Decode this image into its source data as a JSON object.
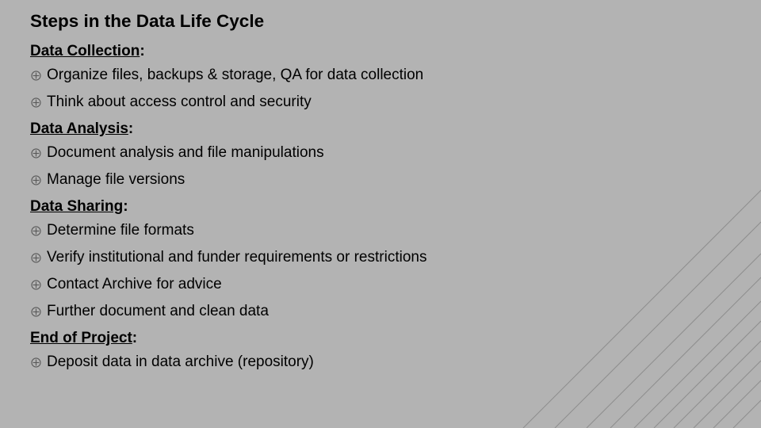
{
  "title": "Steps in the Data Life Cycle",
  "sections": [
    {
      "heading_underlined": "Data Collection",
      "heading_suffix": ":",
      "items": [
        "Organize files, backups & storage, QA for data collection",
        "Think about access control and security"
      ]
    },
    {
      "heading_underlined": "Data Analysis",
      "heading_suffix": ":",
      "items": [
        "Document analysis and file manipulations",
        "Manage file versions"
      ]
    },
    {
      "heading_underlined": "Data Sharing",
      "heading_suffix": ":",
      "items": [
        "Determine file formats",
        "Verify institutional and funder requirements or restrictions",
        "Contact Archive for advice",
        "Further document and clean data"
      ]
    },
    {
      "heading_underlined": "End of Project",
      "heading_suffix": ":",
      "items": [
        "Deposit data in data archive (repository)"
      ]
    }
  ]
}
